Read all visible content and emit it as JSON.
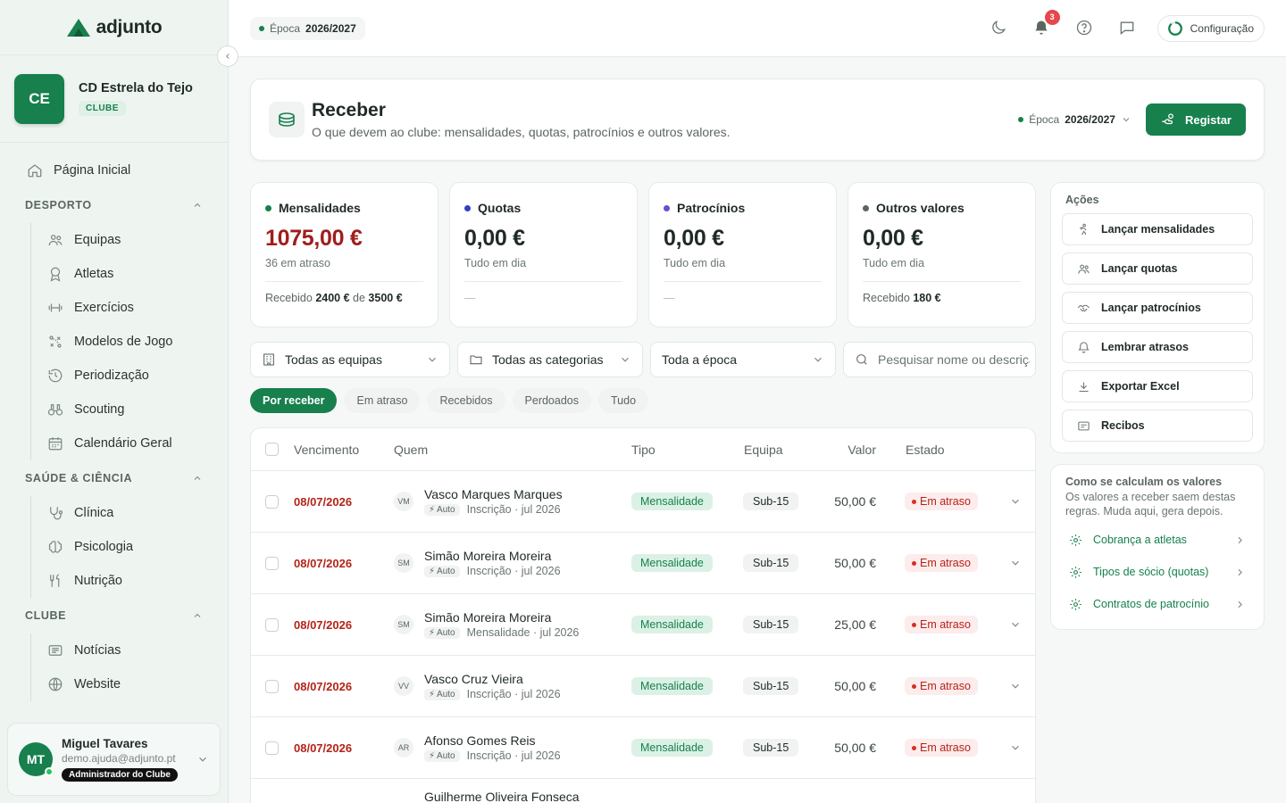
{
  "app": {
    "name": "adjunto"
  },
  "topbar": {
    "season_label": "Época",
    "season_value": "2026/2027",
    "notifications_count": "3",
    "config_label": "Configuração"
  },
  "club": {
    "initials": "CE",
    "name": "CD Estrela do Tejo",
    "badge": "CLUBE"
  },
  "nav": {
    "home": "Página Inicial",
    "sections": [
      {
        "label": "DESPORTO",
        "items": [
          "Equipas",
          "Atletas",
          "Exercícios",
          "Modelos de Jogo",
          "Periodização",
          "Scouting",
          "Calendário Geral"
        ]
      },
      {
        "label": "SAÚDE & CIÊNCIA",
        "items": [
          "Clínica",
          "Psicologia",
          "Nutrição"
        ]
      },
      {
        "label": "CLUBE",
        "items": [
          "Notícias",
          "Website"
        ]
      }
    ]
  },
  "user": {
    "initials": "MT",
    "name": "Miguel Tavares",
    "email": "demo.ajuda@adjunto.pt",
    "role": "Administrador do Clube"
  },
  "header": {
    "title": "Receber",
    "subtitle": "O que devem ao clube: mensalidades, quotas, patrocínios e outros valores.",
    "season_label": "Época",
    "season_value": "2026/2027",
    "register_label": "Registar"
  },
  "kpis": [
    {
      "title": "Mensalidades",
      "value": "1075,00 €",
      "note": "36 em atraso",
      "foot_prefix": "Recebido",
      "foot_a": "2400 €",
      "foot_mid": "de",
      "foot_b": "3500 €",
      "dot": "#17804d",
      "value_color": "#a11d1d"
    },
    {
      "title": "Quotas",
      "value": "0,00 €",
      "note": "Tudo em dia",
      "dash": "—",
      "dot": "#2f3fc7",
      "value_color": "#1f2a24"
    },
    {
      "title": "Patrocínios",
      "value": "0,00 €",
      "note": "Tudo em dia",
      "dash": "—",
      "dot": "#6d4bd6",
      "value_color": "#1f2a24"
    },
    {
      "title": "Outros valores",
      "value": "0,00 €",
      "note": "Tudo em dia",
      "foot_prefix": "Recebido",
      "foot_a": "180 €",
      "dot": "#5b665f",
      "value_color": "#1f2a24"
    }
  ],
  "filters": {
    "team": "Todas as equipas",
    "category": "Todas as categorias",
    "period": "Toda a época",
    "search_placeholder": "Pesquisar nome ou descrição"
  },
  "tabs": [
    "Por receber",
    "Em atraso",
    "Recebidos",
    "Perdoados",
    "Tudo"
  ],
  "table": {
    "headers": {
      "due": "Vencimento",
      "who": "Quem",
      "type": "Tipo",
      "team": "Equipa",
      "value": "Valor",
      "status": "Estado"
    },
    "auto_label": "Auto",
    "rows": [
      {
        "date": "08/07/2026",
        "initials": "VM",
        "name": "Vasco Marques Marques",
        "desc": "Inscrição · jul 2026",
        "type": "Mensalidade",
        "team": "Sub-15",
        "value": "50,00 €",
        "status": "Em atraso"
      },
      {
        "date": "08/07/2026",
        "initials": "SM",
        "name": "Simão Moreira Moreira",
        "desc": "Inscrição · jul 2026",
        "type": "Mensalidade",
        "team": "Sub-15",
        "value": "50,00 €",
        "status": "Em atraso"
      },
      {
        "date": "08/07/2026",
        "initials": "SM",
        "name": "Simão Moreira Moreira",
        "desc": "Mensalidade · jul 2026",
        "type": "Mensalidade",
        "team": "Sub-15",
        "value": "25,00 €",
        "status": "Em atraso"
      },
      {
        "date": "08/07/2026",
        "initials": "VV",
        "name": "Vasco Cruz Vieira",
        "desc": "Inscrição · jul 2026",
        "type": "Mensalidade",
        "team": "Sub-15",
        "value": "50,00 €",
        "status": "Em atraso"
      },
      {
        "date": "08/07/2026",
        "initials": "AR",
        "name": "Afonso Gomes Reis",
        "desc": "Inscrição · jul 2026",
        "type": "Mensalidade",
        "team": "Sub-15",
        "value": "50,00 €",
        "status": "Em atraso"
      },
      {
        "date": "",
        "initials": "",
        "name": "Guilherme Oliveira Fonseca",
        "desc": "",
        "type": "",
        "team": "",
        "value": "",
        "status": ""
      }
    ]
  },
  "actions": {
    "title": "Ações",
    "items": [
      "Lançar mensalidades",
      "Lançar quotas",
      "Lançar patrocínios",
      "Lembrar atrasos",
      "Exportar Excel",
      "Recibos"
    ]
  },
  "info": {
    "title": "Como se calculam os valores",
    "text": "Os valores a receber saem destas regras. Muda aqui, gera depois.",
    "links": [
      "Cobrança a atletas",
      "Tipos de sócio (quotas)",
      "Contratos de patrocínio"
    ]
  }
}
